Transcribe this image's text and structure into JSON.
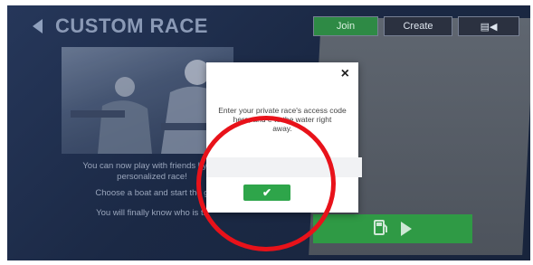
{
  "header": {
    "title": "CUSTOM RACE"
  },
  "intro": {
    "line1": "You can now play with friends by cre",
    "line1b": "personalized race!",
    "line2": "Choose a boat and start the g",
    "line3": "You will finally know who is th"
  },
  "tabs": [
    {
      "label": "Join",
      "active": true
    },
    {
      "label": "Create",
      "active": false
    },
    {
      "label": "▤◀",
      "active": false
    }
  ],
  "dialog": {
    "close_glyph": "×",
    "message_line1": "Enter your private race's access code",
    "message_line2": "here, and   e to the water right",
    "message_line3": "away.",
    "code_value": "",
    "confirm_glyph": "✔"
  },
  "colors": {
    "accent_green": "#2ea54a",
    "highlight_red": "#e8121a",
    "background_navy": "#1b2945"
  }
}
